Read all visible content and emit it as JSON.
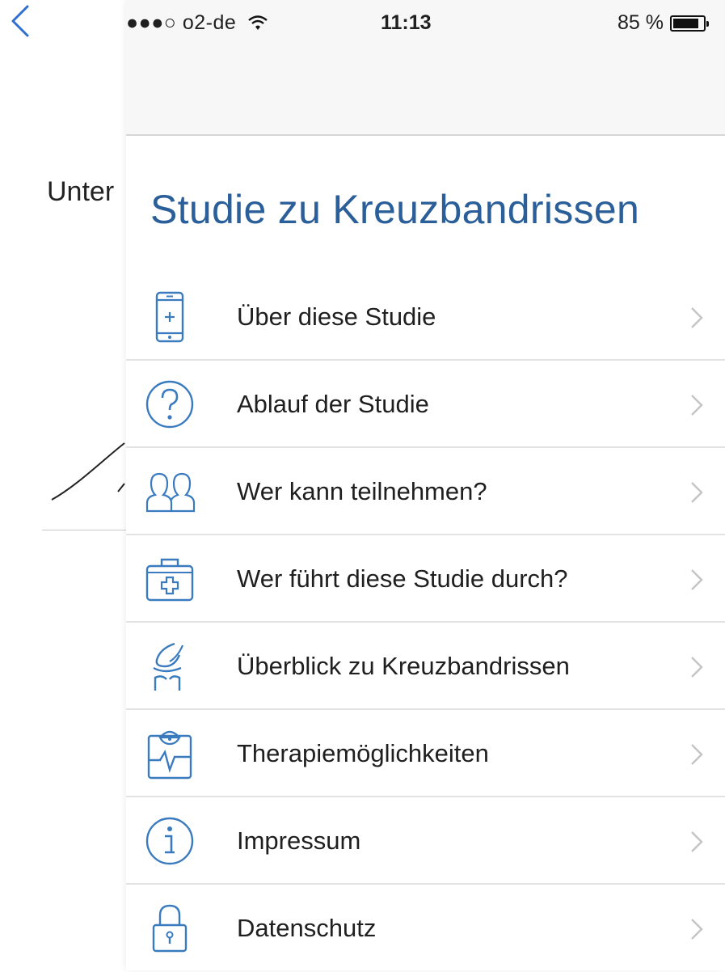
{
  "background": {
    "partial_text": "Unter"
  },
  "status_bar": {
    "carrier": "●●●○ o2-de",
    "time": "11:13",
    "battery": "85 %",
    "battery_level": 0.85
  },
  "panel": {
    "title": "Studie zu Kreuzbandrissen",
    "items": [
      {
        "label": "Über diese Studie",
        "icon": "phone-icon"
      },
      {
        "label": "Ablauf der Studie",
        "icon": "question-icon"
      },
      {
        "label": "Wer kann teilnehmen?",
        "icon": "people-icon"
      },
      {
        "label": "Wer führt diese Studie durch?",
        "icon": "medkit-icon"
      },
      {
        "label": "Überblick zu Kreuzbandrissen",
        "icon": "knee-icon"
      },
      {
        "label": "Therapiemöglichkeiten",
        "icon": "clipboard-pulse-icon"
      },
      {
        "label": "Impressum",
        "icon": "info-icon"
      },
      {
        "label": "Datenschutz",
        "icon": "lock-icon"
      }
    ]
  },
  "colors": {
    "accent": "#2b5f99",
    "icon": "#3a7bbf",
    "chevron": "#c4c4c4"
  }
}
